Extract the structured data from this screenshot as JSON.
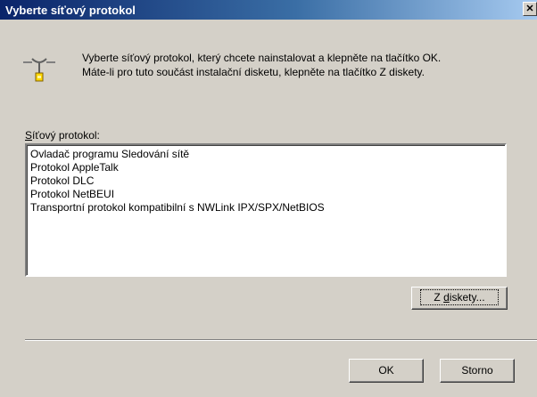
{
  "window": {
    "title": "Vyberte síťový protokol",
    "close_glyph": "✕"
  },
  "description": {
    "line1": "Vyberte síťový protokol, který chcete nainstalovat a klepněte na tlačítko OK.",
    "line2": "Máte-li pro tuto součást instalační disketu, klepněte na tlačítko Z diskety."
  },
  "protocol_list": {
    "label_hotkey": "S",
    "label_rest": "íťový protokol:",
    "items": [
      "Ovladač programu Sledování sítě",
      "Protokol AppleTalk",
      "Protokol DLC",
      "Protokol NetBEUI",
      "Transportní protokol kompatibilní s NWLink IPX/SPX/NetBIOS"
    ]
  },
  "buttons": {
    "from_disk_pre": "Z ",
    "from_disk_hotkey": "d",
    "from_disk_post": "iskety...",
    "ok": "OK",
    "cancel": "Storno"
  },
  "icon": {
    "name": "network-protocol-icon"
  }
}
